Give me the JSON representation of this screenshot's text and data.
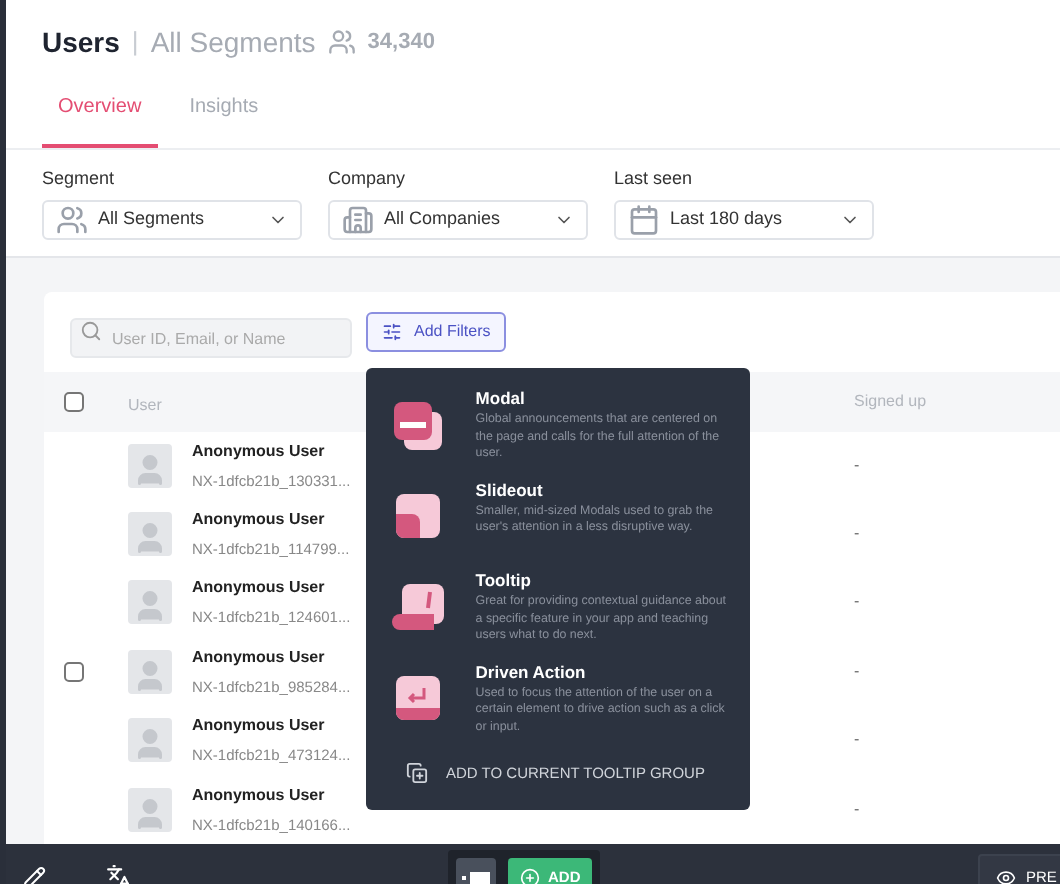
{
  "header": {
    "title": "Users",
    "separator": "|",
    "segment": "All Segments",
    "count": "34,340"
  },
  "tabs": [
    {
      "label": "Overview",
      "selected": true
    },
    {
      "label": "Insights",
      "selected": false
    }
  ],
  "filters": [
    {
      "kind": "segment",
      "label": "Segment",
      "value": "All Segments"
    },
    {
      "kind": "company",
      "label": "Company",
      "value": "All Companies"
    },
    {
      "kind": "date",
      "label": "Last seen",
      "value": "Last 180 days"
    }
  ],
  "search": {
    "placeholder": "User ID, Email, or Name"
  },
  "add_filters": "Add Filters",
  "table": {
    "columns": [
      "User",
      "Signed up"
    ],
    "header_checked": false,
    "rows": [
      {
        "name": "Anonymous User",
        "id": "NX-1dfcb21b_130331...",
        "signed_up": "-",
        "hovered": false
      },
      {
        "name": "Anonymous User",
        "id": "NX-1dfcb21b_114799...",
        "signed_up": "-",
        "hovered": false
      },
      {
        "name": "Anonymous User",
        "id": "NX-1dfcb21b_124601...",
        "signed_up": "-",
        "hovered": false
      },
      {
        "name": "Anonymous User",
        "id": "NX-1dfcb21b_985284...",
        "signed_up": "-",
        "hovered": true
      },
      {
        "name": "Anonymous User",
        "id": "NX-1dfcb21b_473124...",
        "signed_up": "-",
        "hovered": false
      },
      {
        "name": "Anonymous User",
        "id": "NX-1dfcb21b_140166...",
        "signed_up": "-",
        "hovered": false
      }
    ]
  },
  "menu": {
    "items": [
      {
        "kind": "modal",
        "title": "Modal",
        "description": "Global announcements that are centered on the page and calls for the full attention of the user."
      },
      {
        "kind": "slideout",
        "title": "Slideout",
        "description": "Smaller, mid-sized Modals used to grab the user's attention in a less disruptive way."
      },
      {
        "kind": "tooltip",
        "title": "Tooltip",
        "description": "Great for providing contextual guidance about a specific feature in your app and teaching users what to do next."
      },
      {
        "kind": "driven",
        "title": "Driven Action",
        "description": "Used to focus the attention of the user on a certain element to drive action such as a click or input."
      }
    ],
    "footer": "ADD TO CURRENT TOOLTIP GROUP"
  },
  "toolbar": {
    "add": "ADD",
    "preview": "PRE"
  }
}
